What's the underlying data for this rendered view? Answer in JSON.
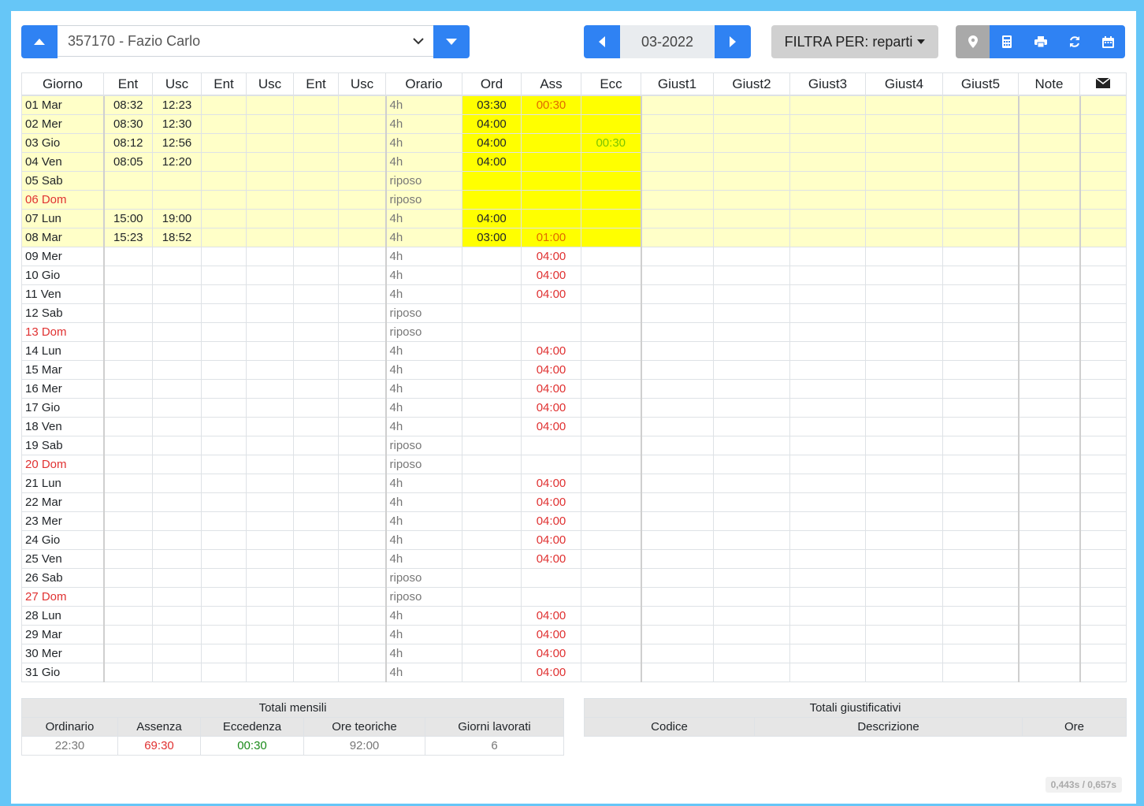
{
  "employee": {
    "label": "357170 - Fazio Carlo"
  },
  "month": {
    "label": "03-2022"
  },
  "filter": {
    "label": "FILTRA PER: reparti"
  },
  "grid": {
    "headers": [
      "Giorno",
      "Ent",
      "Usc",
      "Ent",
      "Usc",
      "Ent",
      "Usc",
      "Orario",
      "Ord",
      "Ass",
      "Ecc",
      "Giust1",
      "Giust2",
      "Giust3",
      "Giust4",
      "Giust5",
      "Note"
    ],
    "rows": [
      {
        "day": "01 Mar",
        "ent1": "08:32",
        "usc1": "12:23",
        "orario": "4h",
        "ord": "03:30",
        "ass": "00:30",
        "ecc": "",
        "hl": true,
        "sun": false
      },
      {
        "day": "02 Mer",
        "ent1": "08:30",
        "usc1": "12:30",
        "orario": "4h",
        "ord": "04:00",
        "ass": "",
        "ecc": "",
        "hl": true,
        "sun": false
      },
      {
        "day": "03 Gio",
        "ent1": "08:12",
        "usc1": "12:56",
        "orario": "4h",
        "ord": "04:00",
        "ass": "",
        "ecc": "00:30",
        "hl": true,
        "sun": false
      },
      {
        "day": "04 Ven",
        "ent1": "08:05",
        "usc1": "12:20",
        "orario": "4h",
        "ord": "04:00",
        "ass": "",
        "ecc": "",
        "hl": true,
        "sun": false
      },
      {
        "day": "05 Sab",
        "ent1": "",
        "usc1": "",
        "orario": "riposo",
        "ord": "",
        "ass": "",
        "ecc": "",
        "hl": true,
        "sun": false
      },
      {
        "day": "06 Dom",
        "ent1": "",
        "usc1": "",
        "orario": "riposo",
        "ord": "",
        "ass": "",
        "ecc": "",
        "hl": true,
        "sun": true
      },
      {
        "day": "07 Lun",
        "ent1": "15:00",
        "usc1": "19:00",
        "orario": "4h",
        "ord": "04:00",
        "ass": "",
        "ecc": "",
        "hl": true,
        "sun": false
      },
      {
        "day": "08 Mar",
        "ent1": "15:23",
        "usc1": "18:52",
        "orario": "4h",
        "ord": "03:00",
        "ass": "01:00",
        "ecc": "",
        "hl": true,
        "sun": false
      },
      {
        "day": "09 Mer",
        "ent1": "",
        "usc1": "",
        "orario": "4h",
        "ord": "",
        "ass": "04:00",
        "ecc": "",
        "hl": false,
        "sun": false
      },
      {
        "day": "10 Gio",
        "ent1": "",
        "usc1": "",
        "orario": "4h",
        "ord": "",
        "ass": "04:00",
        "ecc": "",
        "hl": false,
        "sun": false
      },
      {
        "day": "11 Ven",
        "ent1": "",
        "usc1": "",
        "orario": "4h",
        "ord": "",
        "ass": "04:00",
        "ecc": "",
        "hl": false,
        "sun": false
      },
      {
        "day": "12 Sab",
        "ent1": "",
        "usc1": "",
        "orario": "riposo",
        "ord": "",
        "ass": "",
        "ecc": "",
        "hl": false,
        "sun": false
      },
      {
        "day": "13 Dom",
        "ent1": "",
        "usc1": "",
        "orario": "riposo",
        "ord": "",
        "ass": "",
        "ecc": "",
        "hl": false,
        "sun": true
      },
      {
        "day": "14 Lun",
        "ent1": "",
        "usc1": "",
        "orario": "4h",
        "ord": "",
        "ass": "04:00",
        "ecc": "",
        "hl": false,
        "sun": false
      },
      {
        "day": "15 Mar",
        "ent1": "",
        "usc1": "",
        "orario": "4h",
        "ord": "",
        "ass": "04:00",
        "ecc": "",
        "hl": false,
        "sun": false
      },
      {
        "day": "16 Mer",
        "ent1": "",
        "usc1": "",
        "orario": "4h",
        "ord": "",
        "ass": "04:00",
        "ecc": "",
        "hl": false,
        "sun": false
      },
      {
        "day": "17 Gio",
        "ent1": "",
        "usc1": "",
        "orario": "4h",
        "ord": "",
        "ass": "04:00",
        "ecc": "",
        "hl": false,
        "sun": false
      },
      {
        "day": "18 Ven",
        "ent1": "",
        "usc1": "",
        "orario": "4h",
        "ord": "",
        "ass": "04:00",
        "ecc": "",
        "hl": false,
        "sun": false
      },
      {
        "day": "19 Sab",
        "ent1": "",
        "usc1": "",
        "orario": "riposo",
        "ord": "",
        "ass": "",
        "ecc": "",
        "hl": false,
        "sun": false
      },
      {
        "day": "20 Dom",
        "ent1": "",
        "usc1": "",
        "orario": "riposo",
        "ord": "",
        "ass": "",
        "ecc": "",
        "hl": false,
        "sun": true
      },
      {
        "day": "21 Lun",
        "ent1": "",
        "usc1": "",
        "orario": "4h",
        "ord": "",
        "ass": "04:00",
        "ecc": "",
        "hl": false,
        "sun": false
      },
      {
        "day": "22 Mar",
        "ent1": "",
        "usc1": "",
        "orario": "4h",
        "ord": "",
        "ass": "04:00",
        "ecc": "",
        "hl": false,
        "sun": false
      },
      {
        "day": "23 Mer",
        "ent1": "",
        "usc1": "",
        "orario": "4h",
        "ord": "",
        "ass": "04:00",
        "ecc": "",
        "hl": false,
        "sun": false
      },
      {
        "day": "24 Gio",
        "ent1": "",
        "usc1": "",
        "orario": "4h",
        "ord": "",
        "ass": "04:00",
        "ecc": "",
        "hl": false,
        "sun": false
      },
      {
        "day": "25 Ven",
        "ent1": "",
        "usc1": "",
        "orario": "4h",
        "ord": "",
        "ass": "04:00",
        "ecc": "",
        "hl": false,
        "sun": false
      },
      {
        "day": "26 Sab",
        "ent1": "",
        "usc1": "",
        "orario": "riposo",
        "ord": "",
        "ass": "",
        "ecc": "",
        "hl": false,
        "sun": false
      },
      {
        "day": "27 Dom",
        "ent1": "",
        "usc1": "",
        "orario": "riposo",
        "ord": "",
        "ass": "",
        "ecc": "",
        "hl": false,
        "sun": true
      },
      {
        "day": "28 Lun",
        "ent1": "",
        "usc1": "",
        "orario": "4h",
        "ord": "",
        "ass": "04:00",
        "ecc": "",
        "hl": false,
        "sun": false
      },
      {
        "day": "29 Mar",
        "ent1": "",
        "usc1": "",
        "orario": "4h",
        "ord": "",
        "ass": "04:00",
        "ecc": "",
        "hl": false,
        "sun": false
      },
      {
        "day": "30 Mer",
        "ent1": "",
        "usc1": "",
        "orario": "4h",
        "ord": "",
        "ass": "04:00",
        "ecc": "",
        "hl": false,
        "sun": false
      },
      {
        "day": "31 Gio",
        "ent1": "",
        "usc1": "",
        "orario": "4h",
        "ord": "",
        "ass": "04:00",
        "ecc": "",
        "hl": false,
        "sun": false
      }
    ]
  },
  "totali_mensili": {
    "title": "Totali mensili",
    "headers": [
      "Ordinario",
      "Assenza",
      "Eccedenza",
      "Ore teoriche",
      "Giorni lavorati"
    ],
    "values": [
      "22:30",
      "69:30",
      "00:30",
      "92:00",
      "6"
    ]
  },
  "totali_giustificativi": {
    "title": "Totali giustificativi",
    "headers": [
      "Codice",
      "Descrizione",
      "Ore"
    ]
  },
  "timing": "0,443s / 0,657s",
  "icons": [
    "caret-up-icon",
    "chevron-down-icon",
    "caret-down-icon",
    "caret-left-icon",
    "caret-right-icon",
    "map-pin-icon",
    "calculator-icon",
    "printer-icon",
    "refresh-icon",
    "calendar-icon",
    "envelope-icon"
  ],
  "colors": {
    "primary": "#2f82f3",
    "highlight_row": "#ffffc8",
    "highlight_cell": "#ffff00",
    "absence": "#e03131",
    "excess": "#7cc400",
    "background": "#66c6f7"
  }
}
